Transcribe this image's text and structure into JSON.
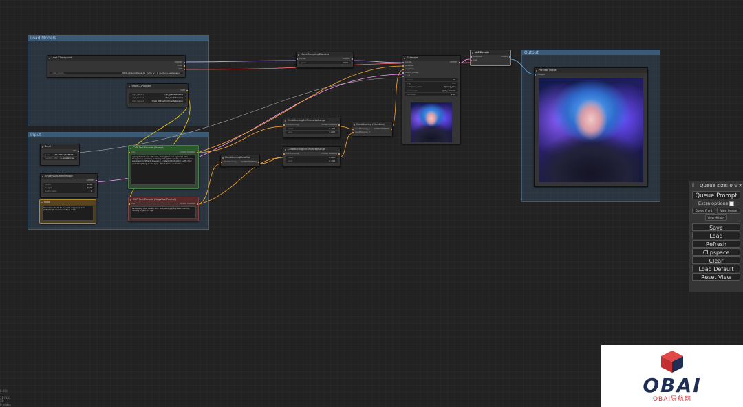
{
  "groups": {
    "load_models": "Load Models",
    "input": "Input",
    "output": "Output"
  },
  "nodes": {
    "checkpoint": {
      "title": "Load Checkpoint",
      "out_model": "MODEL",
      "out_clip": "CLIP",
      "out_vae": "VAE",
      "w_ckpt_label": "ckpt_name",
      "w_ckpt_value": "SDXL\\DreamShaperXL_Turbo_v2_1_medium.safetensors"
    },
    "model_sampling": {
      "title": "ModelSamplingDiscrete",
      "in_model": "model",
      "out_model": "MODEL",
      "w_label": "pred",
      "w_value": "0.00"
    },
    "triple_clip": {
      "title": "TripleCLIPLoader",
      "out_clip": "CLIP",
      "w1_label": "clip_name1",
      "w1_value": "clip_g.safetensors",
      "w2_label": "clip_name2",
      "w2_value": "clip_l.safetensors",
      "w3_label": "clip_name3",
      "w3_value": "t5xxl_fp8_e4m3fn.safetensors"
    },
    "ksampler": {
      "title": "KSampler",
      "in_model": "model",
      "in_positive": "positive",
      "in_negative": "negative",
      "in_latent": "latent_image",
      "in_seed": "seed",
      "out_latent": "LATENT",
      "w_steps_label": "steps",
      "w_steps_value": "20",
      "w_cfg_label": "cfg",
      "w_cfg_value": "5.5",
      "w_sampler_label": "sampler_name",
      "w_sampler_value": "dpmpp_2m",
      "w_scheduler_label": "scheduler",
      "w_scheduler_value": "sgm_uniform",
      "w_denoise_label": "denoise",
      "w_denoise_value": "1.00"
    },
    "vae_decode": {
      "title": "VAE Decode",
      "in_samples": "samples",
      "in_vae": "vae",
      "out_image": "IMAGE"
    },
    "preview": {
      "title": "Preview Image",
      "in_images": "images"
    },
    "seed": {
      "title": "Seed",
      "out_int": "INT",
      "w1_label": "seed",
      "w1_value": "461785723784542",
      "w2_label": "control_after_generate",
      "w2_value": "randomize"
    },
    "empty_latent": {
      "title": "EmptySD3LatentImage",
      "out_latent": "LATENT",
      "w_width_label": "width",
      "w_width_value": "1024",
      "w_height_label": "height",
      "w_height_value": "1024",
      "w_batch_label": "batch_size",
      "w_batch_value": "1"
    },
    "note": {
      "title": "Note",
      "text": "Resolution should be around 1 megapixel and width/height must be multiple of 64"
    },
    "clip_pos": {
      "title": "CLIP Text Encode (Prompt)",
      "in_clip": "clip",
      "out_cond": "CONDITIONING",
      "text": "a (bright character) with long, flowing blue hair against a dark background, sparkling electricity and lightning bolts around her, her expression confident, dressed in a detailed dark gothic outfit, high contrast lighting, anime style, ultra-detailed illustration"
    },
    "clip_neg": {
      "title": "CLIP Text Encode (Negative Prompt)",
      "in_clip": "clip",
      "out_cond": "CONDITIONING",
      "text": "bad quality, poor quality, doll, disfigured, jpg, toy, bad anatomy, missing fingers, 3d, cgi"
    },
    "cond_zero": {
      "title": "ConditioningZeroOut",
      "in_cond": "conditioning",
      "out_cond": "CONDITIONING"
    },
    "cond_range1": {
      "title": "ConditioningSetTimestepRange",
      "in_cond": "conditioning",
      "out_cond": "CONDITIONING",
      "w1_label": "start",
      "w1_value": "0.100",
      "w2_label": "end",
      "w2_value": "1.000"
    },
    "cond_range2": {
      "title": "ConditioningSetTimestepRange",
      "in_cond": "conditioning",
      "out_cond": "CONDITIONING",
      "w1_label": "start",
      "w1_value": "0.000",
      "w2_label": "end",
      "w2_value": "0.100"
    },
    "cond_combine": {
      "title": "Conditioning (Combine)",
      "in1": "conditioning_1",
      "in2": "conditioning_2",
      "out_cond": "CONDITIONING"
    }
  },
  "sidebar": {
    "queue_size": "Queue size: 0",
    "queue_prompt": "Queue Prompt",
    "extra_options": "Extra options",
    "queue_front": "Queue Front",
    "view_queue": "View Queue",
    "view_history": "View History",
    "save": "Save",
    "load": "Load",
    "refresh": "Refresh",
    "clipspace": "Clipspace",
    "clear": "Clear",
    "load_default": "Load Default",
    "reset_view": "Reset View"
  },
  "stats": {
    "line1": "0.00s",
    "line2": "1",
    "line3": "11 [15]",
    "line4": "35",
    "line5": "0 nodes"
  },
  "logo": {
    "text": "OBAI",
    "subtitle": "OBAI导航网"
  },
  "colors": {
    "canvas": "#222222",
    "group_fill": "#3a546e",
    "wire_model": "#b39ddb",
    "wire_clip": "#ffd500",
    "wire_cond": "#ffa931",
    "wire_latent": "#ff9cf9",
    "wire_vae": "#ff6e6e",
    "wire_image": "#64b5f6",
    "wire_int": "#aaaaaa"
  }
}
